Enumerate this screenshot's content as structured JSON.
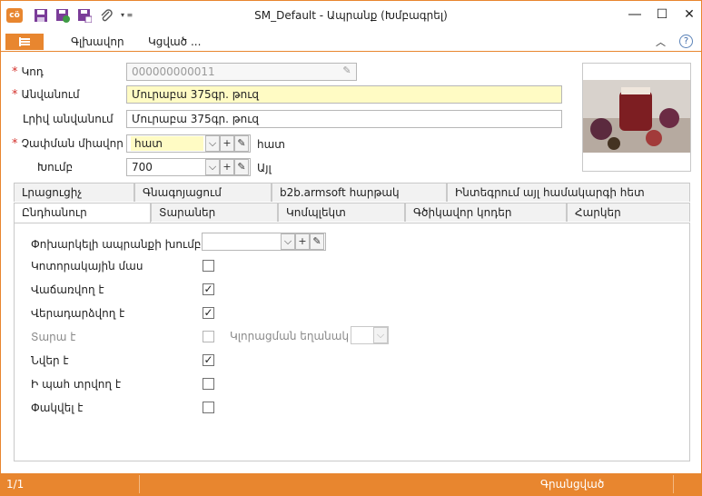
{
  "window": {
    "title": "SM_Default - Ապրանք (Խմբագրել)",
    "controls": [
      "minimize",
      "maximize",
      "close"
    ]
  },
  "quick_access": {
    "icons": [
      "app-logo-icon",
      "save-icon",
      "save-close-icon",
      "save-new-icon",
      "attach-icon",
      "customize-arrow-icon"
    ]
  },
  "ribbon": {
    "tabs": [
      "Գլխավոր",
      "Կցված ..."
    ],
    "help": "?"
  },
  "form": {
    "code": {
      "label": "Կոդ",
      "value": "000000000011",
      "required": true
    },
    "name": {
      "label": "Անվանում",
      "value": "Մուրաբա 375գր. թուզ",
      "required": true
    },
    "full_name": {
      "label": "Լրիվ անվանում",
      "value": "Մուրաբա 375գր. թուզ",
      "required": false
    },
    "unit": {
      "label": "Չափման միավոր",
      "value": "հատ",
      "display": "հատ",
      "required": true
    },
    "group": {
      "label": "Խումբ",
      "value": "700",
      "display": "Այլ",
      "required": false
    }
  },
  "tabs_row1": [
    "Լրացուցիչ",
    "Գնագոյացում",
    "b2b.armsoft հարթակ",
    "Ինտեգրում այլ համակարգի հետ"
  ],
  "tabs_row2": [
    "Ընդհանուր",
    "Տարաներ",
    "Կոմպլեկտ",
    "Գծիկավոր կոդեր",
    "Հարկեր"
  ],
  "general": {
    "alt_group_label": "Փոխարկելի ապրանքի խումբ",
    "alt_group_value": "",
    "rounding_label": "Կլորացման եղանակ",
    "checks": [
      {
        "label": "Կոտորակային մաս",
        "checked": false,
        "disabled": false
      },
      {
        "label": "Վաճառվող է",
        "checked": true,
        "disabled": false
      },
      {
        "label": "Վերադարձվող է",
        "checked": true,
        "disabled": false
      },
      {
        "label": "Տարա է",
        "checked": false,
        "disabled": true
      },
      {
        "label": "Նվեր է",
        "checked": true,
        "disabled": false
      },
      {
        "label": "Ի պահ տրվող է",
        "checked": false,
        "disabled": false
      },
      {
        "label": "Փակվել է",
        "checked": false,
        "disabled": false
      }
    ]
  },
  "status": {
    "record": "1/1",
    "state": "Գրանցված"
  },
  "colors": {
    "accent": "#e8862f",
    "required": "#d3302b",
    "highlight": "#fffbc4"
  }
}
